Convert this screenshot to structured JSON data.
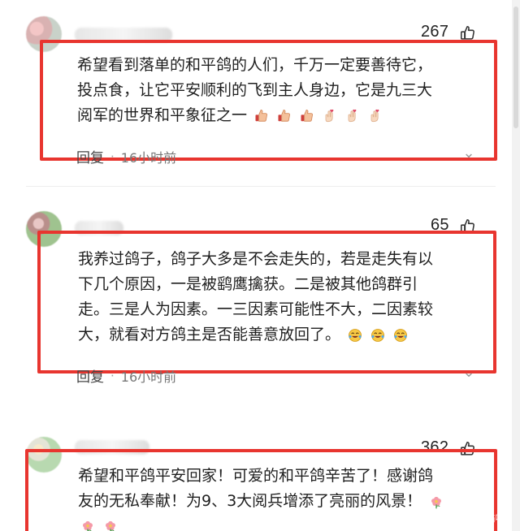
{
  "comments": [
    {
      "like_count": "267",
      "text_lines": [
        "希望看到落单的和平鸽的人们，千万一定要善待它，",
        "投点食，让它平安顺利的飞到主人身边，它是九三大",
        "阅军的世界和平象征之一"
      ],
      "reply_label": "回复",
      "time": "16小时前",
      "emoji_sequence": [
        "thumbs-up",
        "thumbs-up",
        "thumbs-up",
        "heart-hand",
        "heart-hand",
        "heart-hand"
      ]
    },
    {
      "like_count": "65",
      "text_lines": [
        "我养过鸽子，鸽子大多是不会走失的，若是走失有以",
        "下几个原因，一是被鹞鹰擒获。二是被其他鸽群引",
        "走。三是人为因素。一三因素可能性不大，二因素较",
        "大，就看对方鸽主是否能善意放回了。"
      ],
      "reply_label": "回复",
      "time": "16小时前",
      "emoji_sequence": [
        "laugh-cry",
        "laugh-cry",
        "laugh-cry"
      ]
    },
    {
      "like_count": "362",
      "text_lines": [
        "希望和平鸽平安回家！可爱的和平鸽辛苦了！感谢鸽",
        "友的无私奉献！为9、3大阅兵增添了亮丽的风景！"
      ],
      "emoji_sequence": [
        "flower",
        "flower",
        "flower"
      ]
    }
  ],
  "watermark": "猫咪..."
}
